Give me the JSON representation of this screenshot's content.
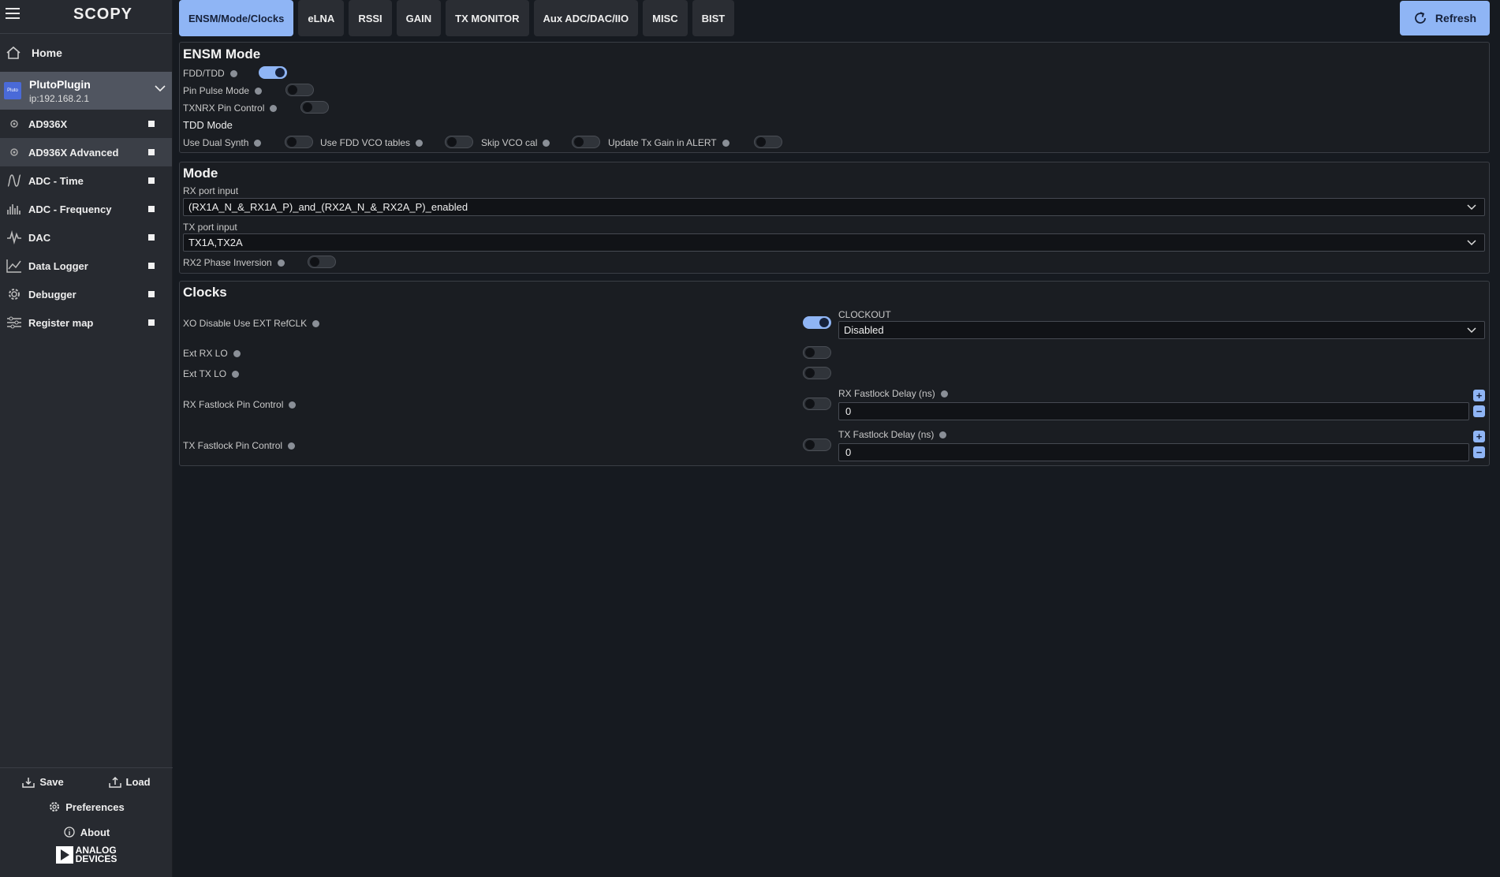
{
  "app": {
    "logo": "SCOPY"
  },
  "sidebar": {
    "home": "Home",
    "plugin": {
      "name": "PlutoPlugin",
      "ip": "ip:192.168.2.1",
      "icon_text": "Pluto"
    },
    "items": [
      {
        "label": "AD936X",
        "icon": "gear-icon"
      },
      {
        "label": "AD936X Advanced",
        "icon": "gear-icon"
      },
      {
        "label": "ADC - Time",
        "icon": "waveform-icon"
      },
      {
        "label": "ADC - Frequency",
        "icon": "spectrum-icon"
      },
      {
        "label": "DAC",
        "icon": "signal-icon"
      },
      {
        "label": "Data Logger",
        "icon": "chart-icon"
      },
      {
        "label": "Debugger",
        "icon": "gear-icon"
      },
      {
        "label": "Register map",
        "icon": "sliders-icon"
      }
    ],
    "save": "Save",
    "load": "Load",
    "preferences": "Preferences",
    "about": "About",
    "company_line1": "ANALOG",
    "company_line2": "DEVICES"
  },
  "tabs": [
    "ENSM/Mode/Clocks",
    "eLNA",
    "RSSI",
    "GAIN",
    "TX MONITOR",
    "Aux ADC/DAC/IIO",
    "MISC",
    "BIST"
  ],
  "active_tab": "ENSM/Mode/Clocks",
  "refresh_label": "Refresh",
  "ensm": {
    "title": "ENSM Mode",
    "fdd_tdd": {
      "label": "FDD/TDD",
      "on": true
    },
    "pin_pulse": {
      "label": "Pin Pulse Mode",
      "on": false
    },
    "txnrx": {
      "label": "TXNRX Pin Control",
      "on": false
    },
    "tdd_mode": "TDD Mode",
    "dual_synth": {
      "label": "Use Dual Synth",
      "on": false
    },
    "fdd_vco": {
      "label": "Use FDD VCO tables",
      "on": false
    },
    "skip_vco": {
      "label": "Skip VCO cal",
      "on": false
    },
    "update_tx": {
      "label": "Update Tx Gain in ALERT",
      "on": false
    }
  },
  "mode": {
    "title": "Mode",
    "rx_port_label": "RX port input",
    "rx_port_value": "(RX1A_N_&_RX1A_P)_and_(RX2A_N_&_RX2A_P)_enabled",
    "tx_port_label": "TX port input",
    "tx_port_value": "TX1A,TX2A",
    "rx2_phase": {
      "label": "RX2 Phase Inversion",
      "on": false
    }
  },
  "clocks": {
    "title": "Clocks",
    "xo_disable": {
      "label": "XO Disable Use EXT RefCLK",
      "on": true
    },
    "clockout_label": "CLOCKOUT",
    "clockout_value": "Disabled",
    "ext_rx_lo": {
      "label": "Ext RX LO",
      "on": false
    },
    "ext_tx_lo": {
      "label": "Ext TX LO",
      "on": false
    },
    "rx_fastlock": {
      "label": "RX Fastlock Pin Control",
      "on": false
    },
    "rx_fastlock_delay_label": "RX Fastlock Delay (ns)",
    "rx_fastlock_delay_value": "0",
    "tx_fastlock": {
      "label": "TX Fastlock Pin Control",
      "on": false
    },
    "tx_fastlock_delay_label": "TX Fastlock Delay (ns)",
    "tx_fastlock_delay_value": "0"
  },
  "colors": {
    "accent": "#8fb5f5",
    "background": "#161a20",
    "sidebar": "#272a30"
  }
}
